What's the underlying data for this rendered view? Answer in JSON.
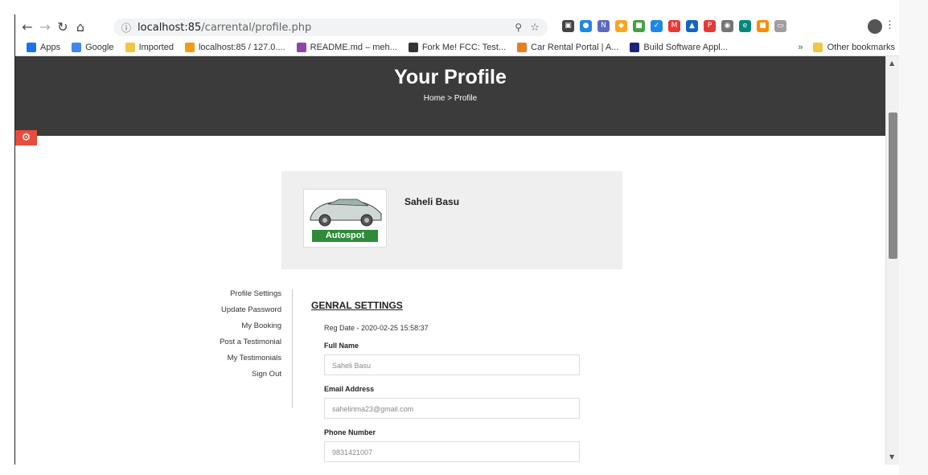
{
  "browser": {
    "url_host": "localhost:85",
    "url_path": "/carrental/profile.php",
    "extensions": [
      {
        "name": "ext-1",
        "color": "#444444",
        "glyph": "▣"
      },
      {
        "name": "ext-2",
        "color": "#1e88e5",
        "glyph": "●"
      },
      {
        "name": "ext-3",
        "color": "#5c6bc0",
        "glyph": "N"
      },
      {
        "name": "ext-4",
        "color": "#f5a623",
        "glyph": "◆"
      },
      {
        "name": "ext-5",
        "color": "#43a047",
        "glyph": "■"
      },
      {
        "name": "ext-6",
        "color": "#1e88e5",
        "glyph": "✓"
      },
      {
        "name": "ext-7",
        "color": "#e53935",
        "glyph": "M"
      },
      {
        "name": "ext-8",
        "color": "#1565c0",
        "glyph": "▲"
      },
      {
        "name": "ext-9",
        "color": "#e53935",
        "glyph": "P"
      },
      {
        "name": "ext-10",
        "color": "#757575",
        "glyph": "◉"
      },
      {
        "name": "ext-11",
        "color": "#00897b",
        "glyph": "e"
      },
      {
        "name": "ext-12",
        "color": "#fb8c00",
        "glyph": "■"
      },
      {
        "name": "ext-13",
        "color": "#9e9e9e",
        "glyph": "▭"
      }
    ]
  },
  "bookmarks": {
    "items": [
      {
        "label": "Apps",
        "color": "#1a73e8"
      },
      {
        "label": "Google",
        "color": "#4285f4"
      },
      {
        "label": "Imported",
        "color": "#f4c542"
      },
      {
        "label": "localhost:85 / 127.0....",
        "color": "#f39c12"
      },
      {
        "label": "README.md – meh...",
        "color": "#8e44ad"
      },
      {
        "label": "Fork Me! FCC: Test...",
        "color": "#333333"
      },
      {
        "label": "Car Rental Portal | A...",
        "color": "#e67e22"
      },
      {
        "label": "Build Software Appl...",
        "color": "#1a237e"
      }
    ],
    "more": "»",
    "other": "Other bookmarks"
  },
  "hero": {
    "title": "Your Profile",
    "breadcrumb": "Home > Profile"
  },
  "profile": {
    "name": "Saheli Basu",
    "logo_text": "Autospot"
  },
  "sidebar": {
    "items": [
      "Profile Settings",
      "Update Password",
      "My Booking",
      "Post a Testimonial",
      "My Testimonials",
      "Sign Out"
    ]
  },
  "settings": {
    "title": "GENRAL SETTINGS",
    "reg_date": "Reg Date - 2020-02-25 15:58:37",
    "full_name_label": "Full Name",
    "full_name_value": "Saheli Basu",
    "email_label": "Email Address",
    "email_value": "sahelirima23@gmail.com",
    "phone_label": "Phone Number",
    "phone_value": "9831421007"
  }
}
